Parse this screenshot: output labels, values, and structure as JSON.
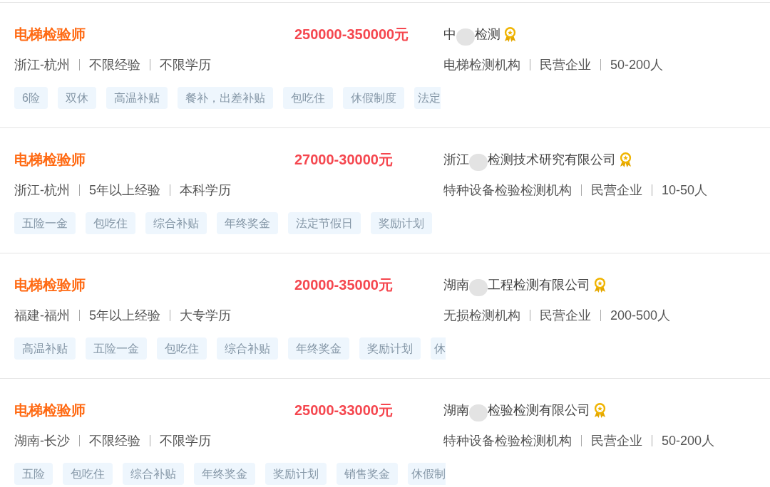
{
  "jobs": [
    {
      "title": "电梯检验师",
      "salary": "250000-350000元",
      "company_name": [
        "中",
        "检测"
      ],
      "verified": true,
      "location": "浙江-杭州",
      "experience": "不限经验",
      "education": "不限学历",
      "industry": "电梯检测机构",
      "company_type": "民营企业",
      "company_size": "50-200人",
      "tags": [
        "6险",
        "双休",
        "高温补贴",
        "餐补，出差补贴",
        "包吃住",
        "休假制度",
        "法定"
      ]
    },
    {
      "title": "电梯检验师",
      "salary": "27000-30000元",
      "company_name": [
        "浙江",
        "检测技术研究有限公司"
      ],
      "verified": true,
      "location": "浙江-杭州",
      "experience": "5年以上经验",
      "education": "本科学历",
      "industry": "特种设备检验检测机构",
      "company_type": "民营企业",
      "company_size": "10-50人",
      "tags": [
        "五险一金",
        "包吃住",
        "综合补贴",
        "年终奖金",
        "法定节假日",
        "奖励计划"
      ]
    },
    {
      "title": "电梯检验师",
      "salary": "20000-35000元",
      "company_name": [
        "湖南",
        "工程检测有限公司"
      ],
      "verified": true,
      "location": "福建-福州",
      "experience": "5年以上经验",
      "education": "大专学历",
      "industry": "无损检测机构",
      "company_type": "民营企业",
      "company_size": "200-500人",
      "tags": [
        "高温补贴",
        "五险一金",
        "包吃住",
        "综合补贴",
        "年终奖金",
        "奖励计划",
        "休"
      ]
    },
    {
      "title": "电梯检验师",
      "salary": "25000-33000元",
      "company_name": [
        "湖南",
        "检验检测有限公司"
      ],
      "verified": true,
      "location": "湖南-长沙",
      "experience": "不限经验",
      "education": "不限学历",
      "industry": "特种设备检验检测机构",
      "company_type": "民营企业",
      "company_size": "50-200人",
      "tags": [
        "五险",
        "包吃住",
        "综合补贴",
        "年终奖金",
        "奖励计划",
        "销售奖金",
        "休假制"
      ]
    }
  ]
}
